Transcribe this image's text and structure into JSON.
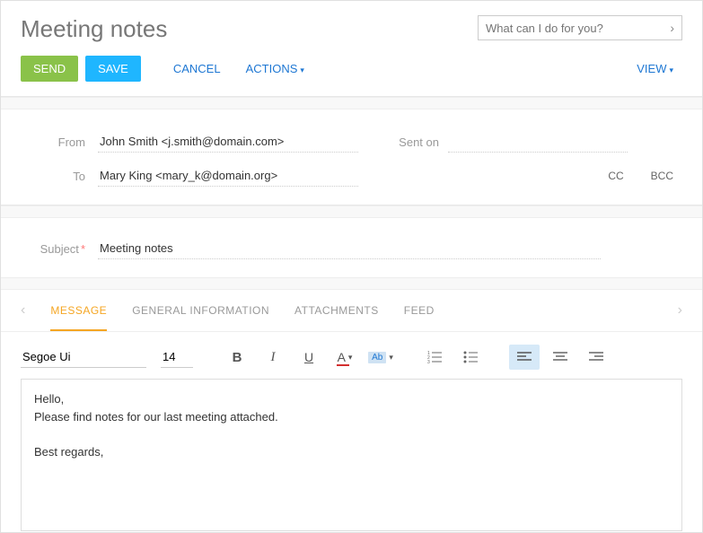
{
  "header": {
    "title": "Meeting notes",
    "search_placeholder": "What can I do for you?"
  },
  "toolbar": {
    "send": "SEND",
    "save": "SAVE",
    "cancel": "CANCEL",
    "actions": "ACTIONS",
    "view": "VIEW"
  },
  "fields": {
    "from_label": "From",
    "from_value": "John Smith <j.smith@domain.com>",
    "sent_on_label": "Sent on",
    "sent_on_value": "",
    "to_label": "To",
    "to_value": "Mary King <mary_k@domain.org>",
    "cc": "CC",
    "bcc": "BCC",
    "subject_label": "Subject",
    "subject_value": "Meeting notes"
  },
  "tabs": {
    "message": "MESSAGE",
    "general": "GENERAL INFORMATION",
    "attachments": "ATTACHMENTS",
    "feed": "FEED"
  },
  "editor": {
    "font_name": "Segoe Ui",
    "font_size": "14",
    "body": "Hello,\nPlease find notes for our last meeting attached.\n\nBest regards,"
  }
}
